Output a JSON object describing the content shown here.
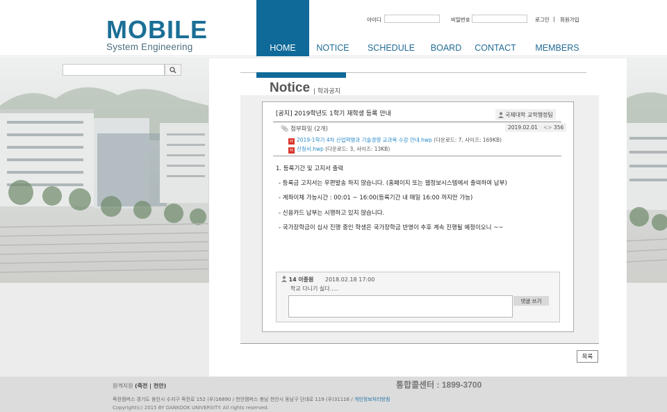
{
  "logo": {
    "line1": "MOBILE",
    "line2": "System Engineering"
  },
  "nav": [
    {
      "label": "HOME"
    },
    {
      "label": "NOTICE"
    },
    {
      "label": "SCHEDULE"
    },
    {
      "label": "BOARD"
    },
    {
      "label": "CONTACT"
    },
    {
      "label": "MEMBERS"
    }
  ],
  "login": {
    "id_label": "아이디",
    "pw_label": "비밀번호",
    "login_link": "로그인",
    "separator": "|",
    "join_link": "회원가입"
  },
  "search": {
    "button_icon": "search-icon"
  },
  "page": {
    "title": "Notice",
    "subtitle": "| 학과공지"
  },
  "post": {
    "title": "[공지] 2019학년도 1학기 재학생 등록 안내",
    "author": "국제대학 교학행정팀",
    "attachments_label": "첨부파일 (2개)",
    "date": "2019.02.01",
    "views": "356",
    "files": [
      {
        "name": "2019-1학기 4차 산업혁명과 기술경영 교과목 수강 안내.hwp",
        "meta": "(다운로드: 7, 사이즈: 169KB)"
      },
      {
        "name": "신청서.hwp",
        "meta": "(다운로드: 3, 사이즈: 13KB)"
      }
    ],
    "body": [
      "1. 등록기간 및 고지서 출력",
      "- 등록금 고지서는 우편발송 하지 않습니다. (홈페이지 또는 웹정보시스템에서 출력하여 납부)",
      "- 계좌이체 가능시간 : 00:01 ~ 16:00(등록기간 내 매일 16:00 까지만 가능)",
      "- 신용카드 납부는 시행하고 있지 않습니다.",
      "- 국가장학금이 심사 진행 중인 학생은 국가장학금 반영이 추후 계속 진행될 예정이오니 ~~"
    ]
  },
  "comment": {
    "number": "14",
    "author": "이종원",
    "date": "2018.02.18 17:00",
    "text": "학교 다니기 싫다.....",
    "submit_label": "댓글 쓰기"
  },
  "list_button": "목록",
  "footer": {
    "campus_label": "원격지원",
    "campus_links": "(죽전 | 천안)",
    "call_center": "통합콜센터 : 1899-3700",
    "address": "죽전캠퍼스 경기도 용인시 수지구 죽전로 152 (우)16890 / 천안캠퍼스 충남 천안시 동남구 단대로 119 (우)31116 /",
    "privacy": "개인정보처리방침",
    "copyright": "Copyright(c) 2015 BY DANKOOK UNIVERSITY. All rights reserved."
  },
  "colors": {
    "brand": "#0f6a99",
    "link": "#2a8acb"
  }
}
